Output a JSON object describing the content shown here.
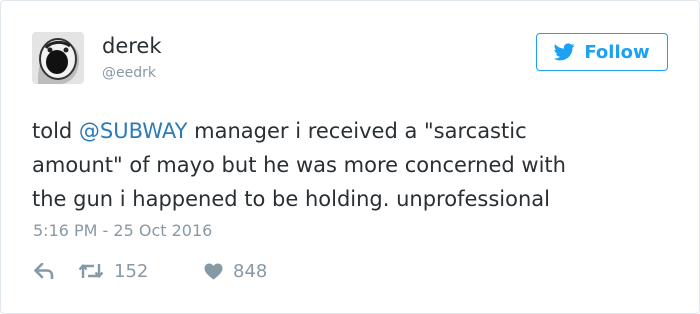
{
  "user": {
    "display_name": "derek",
    "handle": "@eedrk"
  },
  "follow_button": {
    "label": "Follow",
    "icon": "twitter-bird-icon"
  },
  "tweet": {
    "text_before": "told ",
    "mention": "@SUBWAY",
    "text_line1_after": " manager i received a \"sarcastic",
    "text_line2": "amount\" of mayo but he was more concerned with",
    "text_line3": "the gun i happened to be holding. unprofessional",
    "timestamp": "5:16 PM - 25 Oct 2016"
  },
  "actions": {
    "reply_icon": "reply-icon",
    "retweet_icon": "retweet-icon",
    "retweet_count": "152",
    "like_icon": "heart-icon",
    "like_count": "848"
  },
  "colors": {
    "accent": "#1da1f2",
    "mention": "#2b7bb9",
    "muted": "#8899a6",
    "text": "#292f33",
    "border": "#e1e8ed"
  }
}
